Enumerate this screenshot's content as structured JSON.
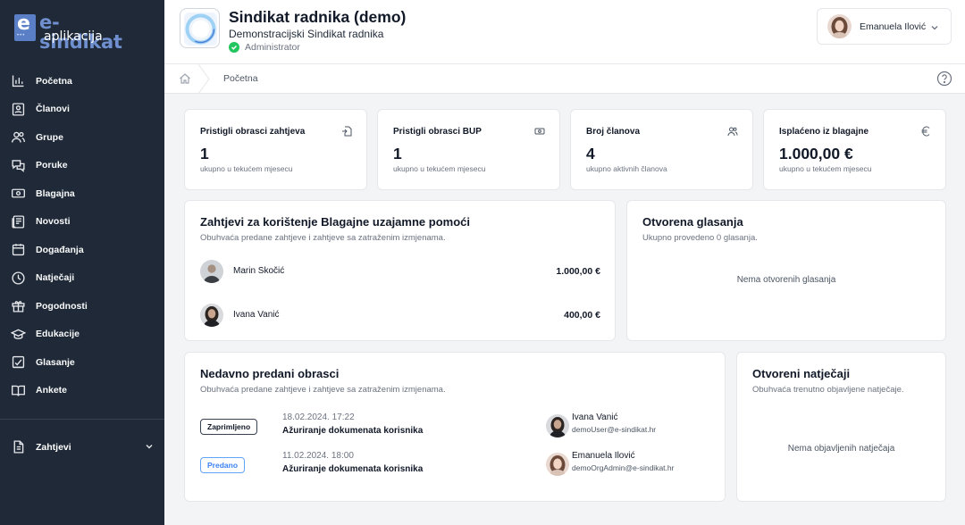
{
  "app": {
    "logo_main": "e-sindikat",
    "logo_sub": "aplikacija"
  },
  "sidebar": {
    "items": [
      {
        "label": "Početna",
        "icon": "chart-bars-icon"
      },
      {
        "label": "Članovi",
        "icon": "id-card-icon"
      },
      {
        "label": "Grupe",
        "icon": "users-icon"
      },
      {
        "label": "Poruke",
        "icon": "chat-icon"
      },
      {
        "label": "Blagajna",
        "icon": "banknote-icon"
      },
      {
        "label": "Novosti",
        "icon": "newspaper-icon"
      },
      {
        "label": "Događanja",
        "icon": "calendar-icon"
      },
      {
        "label": "Natječaji",
        "icon": "clock-icon"
      },
      {
        "label": "Pogodnosti",
        "icon": "gift-icon"
      },
      {
        "label": "Edukacije",
        "icon": "graduation-cap-icon"
      },
      {
        "label": "Glasanje",
        "icon": "vote-icon"
      },
      {
        "label": "Ankete",
        "icon": "book-open-icon"
      }
    ],
    "requests": {
      "label": "Zahtjevi",
      "icon": "document-icon"
    }
  },
  "header": {
    "org_name": "Sindikat radnika (demo)",
    "org_subtitle": "Demonstracijski Sindikat radnika",
    "role": "Administrator",
    "user_name": "Emanuela Ilović"
  },
  "breadcrumb": {
    "current": "Početna"
  },
  "stats": [
    {
      "title": "Pristigli obrasci zahtjeva",
      "value": "1",
      "sub": "ukupno u tekućem mjesecu",
      "icon": "file-import-icon"
    },
    {
      "title": "Pristigli obrasci BUP",
      "value": "1",
      "sub": "ukupno u tekućem mjesecu",
      "icon": "banknote-icon"
    },
    {
      "title": "Broj članova",
      "value": "4",
      "sub": "ukupno aktivnih članova",
      "icon": "users-icon"
    },
    {
      "title": "Isplaćeno iz blagajne",
      "value": "1.000,00 €",
      "sub": "ukupno u tekućem mjesecu",
      "icon": "euro-icon"
    }
  ],
  "requests_panel": {
    "title": "Zahtjevi za korištenje Blagajne uzajamne pomoći",
    "subtitle": "Obuhvaća predane zahtjeve i zahtjeve sa zatraženim izmjenama.",
    "rows": [
      {
        "name": "Marin Skočić",
        "amount": "1.000,00 €"
      },
      {
        "name": "Ivana Vanić",
        "amount": "400,00 €"
      }
    ]
  },
  "voting_panel": {
    "title": "Otvorena glasanja",
    "subtitle": "Ukupno provedeno 0 glasanja.",
    "empty": "Nema otvorenih glasanja"
  },
  "forms_panel": {
    "title": "Nedavno predani obrasci",
    "subtitle": "Obuhvaća predane zahtjeve i zahtjeve sa zatraženim izmjenama.",
    "rows": [
      {
        "status": "Zaprimljeno",
        "date": "18.02.2024. 17:22",
        "title": "Ažuriranje dokumenata korisnika",
        "user": "Ivana Vanić",
        "email": "demoUser@e-sindikat.hr"
      },
      {
        "status": "Predano",
        "date": "11.02.2024. 18:00",
        "title": "Ažuriranje dokumenata korisnika",
        "user": "Emanuela Ilović",
        "email": "demoOrgAdmin@e-sindikat.hr"
      }
    ]
  },
  "tenders_panel": {
    "title": "Otvoreni natječaji",
    "subtitle": "Obuhvaća trenutno objavljene natječaje.",
    "empty": "Nema objavljenih natječaja"
  },
  "colors": {
    "sidebar_bg": "#1f2937",
    "logo_blue": "#5b7fc7",
    "success": "#22c55e",
    "info": "#3b82f6"
  }
}
